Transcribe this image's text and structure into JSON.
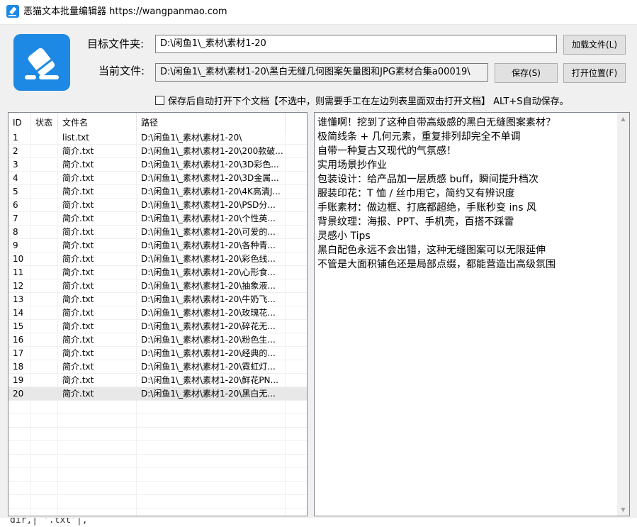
{
  "window": {
    "title": "恶猫文本批量编辑器 https://wangpanmao.com"
  },
  "colors": {
    "accent": "#1e88e5",
    "selection": "#e8e8e8"
  },
  "top": {
    "target_folder_label": "目标文件夹:",
    "target_folder_value": "D:\\闲鱼1\\_素材\\素材1-20",
    "current_file_label": "当前文件:",
    "current_file_value": "D:\\闲鱼1\\_素材\\素材1-20\\黑白无缝几何图案矢量图和JPG素材合集a00019\\",
    "load_button": "加载文件(L)",
    "save_button": "保存(S)",
    "open_location_button": "打开位置(F)",
    "autoopen_label": "保存后自动打开下个文档【不选中，则需要手工在左边列表里面双击打开文档】 ALT+S自动保存。",
    "autoopen_checked": false
  },
  "list": {
    "columns": [
      "ID",
      "状态",
      "文件名",
      "路径"
    ],
    "rows": [
      {
        "id": "1",
        "status": "",
        "file": "list.txt",
        "path": "D:\\闲鱼1\\_素材\\素材1-20\\"
      },
      {
        "id": "2",
        "status": "",
        "file": "简介.txt",
        "path": "D:\\闲鱼1\\_素材\\素材1-20\\200款破..."
      },
      {
        "id": "3",
        "status": "",
        "file": "简介.txt",
        "path": "D:\\闲鱼1\\_素材\\素材1-20\\3D彩色..."
      },
      {
        "id": "4",
        "status": "",
        "file": "简介.txt",
        "path": "D:\\闲鱼1\\_素材\\素材1-20\\3D金属..."
      },
      {
        "id": "5",
        "status": "",
        "file": "简介.txt",
        "path": "D:\\闲鱼1\\_素材\\素材1-20\\4K高清J..."
      },
      {
        "id": "6",
        "status": "",
        "file": "简介.txt",
        "path": "D:\\闲鱼1\\_素材\\素材1-20\\PSD分..."
      },
      {
        "id": "7",
        "status": "",
        "file": "简介.txt",
        "path": "D:\\闲鱼1\\_素材\\素材1-20\\个性英..."
      },
      {
        "id": "8",
        "status": "",
        "file": "简介.txt",
        "path": "D:\\闲鱼1\\_素材\\素材1-20\\可爱的..."
      },
      {
        "id": "9",
        "status": "",
        "file": "简介.txt",
        "path": "D:\\闲鱼1\\_素材\\素材1-20\\各种青..."
      },
      {
        "id": "10",
        "status": "",
        "file": "简介.txt",
        "path": "D:\\闲鱼1\\_素材\\素材1-20\\彩色线..."
      },
      {
        "id": "11",
        "status": "",
        "file": "简介.txt",
        "path": "D:\\闲鱼1\\_素材\\素材1-20\\心形食..."
      },
      {
        "id": "12",
        "status": "",
        "file": "简介.txt",
        "path": "D:\\闲鱼1\\_素材\\素材1-20\\抽象液..."
      },
      {
        "id": "13",
        "status": "",
        "file": "简介.txt",
        "path": "D:\\闲鱼1\\_素材\\素材1-20\\牛奶飞..."
      },
      {
        "id": "14",
        "status": "",
        "file": "简介.txt",
        "path": "D:\\闲鱼1\\_素材\\素材1-20\\玫瑰花..."
      },
      {
        "id": "15",
        "status": "",
        "file": "简介.txt",
        "path": "D:\\闲鱼1\\_素材\\素材1-20\\碎花无..."
      },
      {
        "id": "16",
        "status": "",
        "file": "简介.txt",
        "path": "D:\\闲鱼1\\_素材\\素材1-20\\粉色生..."
      },
      {
        "id": "17",
        "status": "",
        "file": "简介.txt",
        "path": "D:\\闲鱼1\\_素材\\素材1-20\\经典的..."
      },
      {
        "id": "18",
        "status": "",
        "file": "简介.txt",
        "path": "D:\\闲鱼1\\_素材\\素材1-20\\霓虹灯..."
      },
      {
        "id": "19",
        "status": "",
        "file": "简介.txt",
        "path": "D:\\闲鱼1\\_素材\\素材1-20\\鲜花PN..."
      },
      {
        "id": "20",
        "status": "",
        "file": "简介.txt",
        "path": "D:\\闲鱼1\\_素材\\素材1-20\\黑白无...",
        "selected": true
      }
    ]
  },
  "editor": {
    "lines": [
      "谁懂啊！挖到了这种自带高级感的黑白无缝图案素材？",
      "极简线条 + 几何元素，重复排列却完全不单调",
      "自带一种复古又现代的气氛感！",
      "实用场景抄作业",
      "包装设计：给产品加一层质感 buff，瞬间提升档次",
      "服装印花：T 恤 / 丝巾用它，简约又有辨识度",
      "手账素材：做边框、打底都超绝，手账秒变 ins 风",
      "背景纹理：海报、PPT、手机壳，百搭不踩雷",
      "灵感小 Tips",
      "黑白配色永远不会出错，这种无缝图案可以无限延伸",
      "不管是大面积铺色还是局部点缀，都能营造出高级氛围"
    ]
  },
  "background_peek": {
    "text": "dir,| '.txt'|,"
  }
}
